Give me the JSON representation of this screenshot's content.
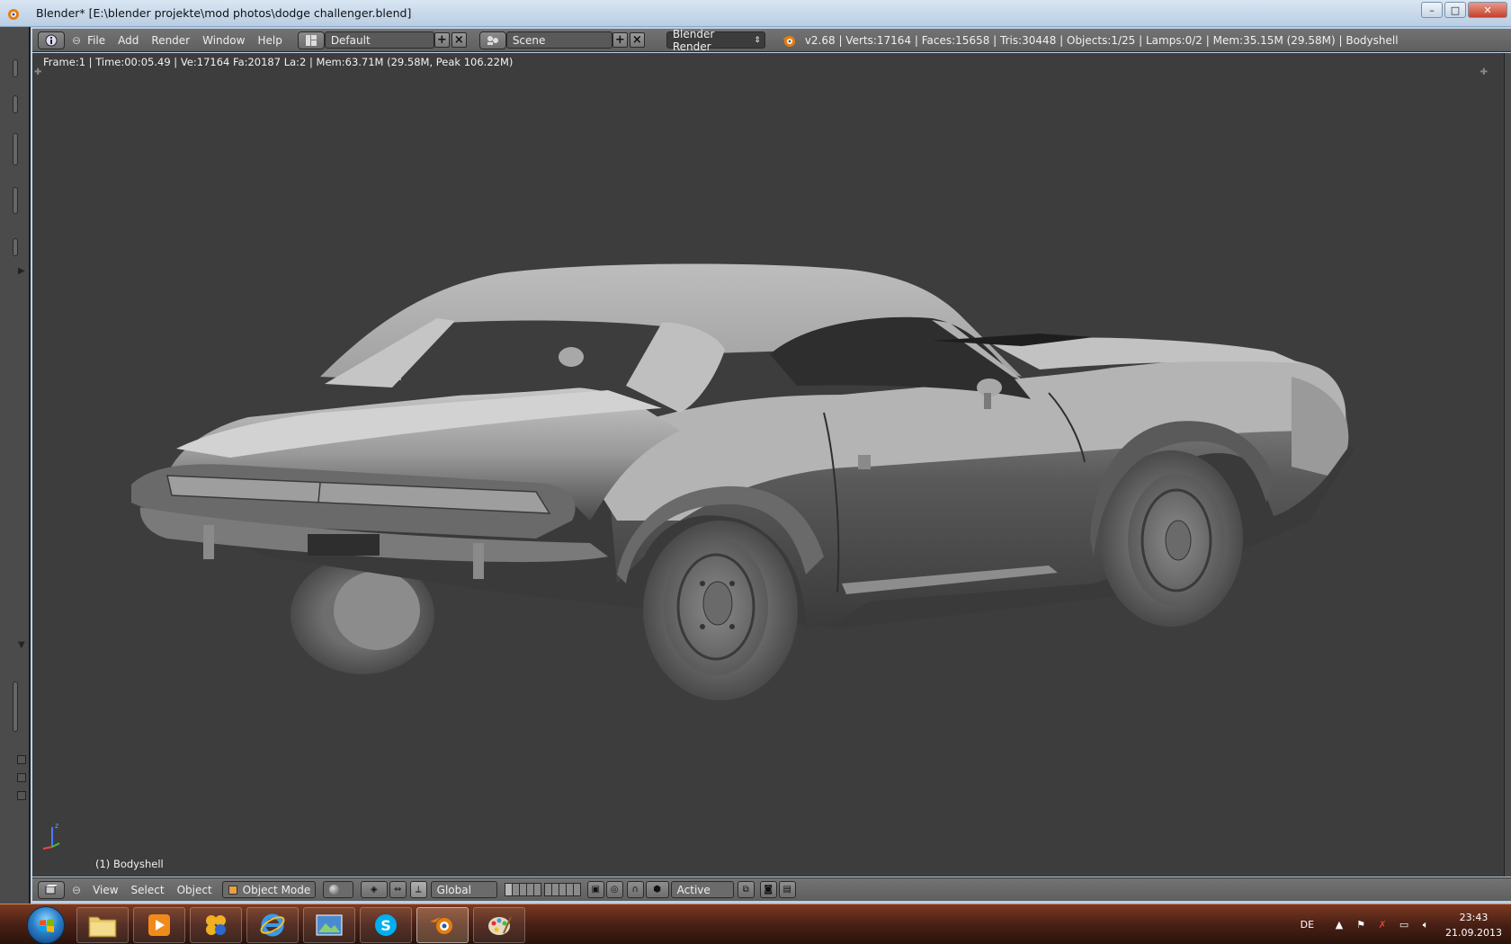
{
  "window": {
    "title": "Blender* [E:\\blender projekte\\mod photos\\dodge challenger.blend]",
    "controls": {
      "minimize": "–",
      "maximize": "□",
      "close": "✕"
    }
  },
  "info_header": {
    "menus": [
      "File",
      "Add",
      "Render",
      "Window",
      "Help"
    ],
    "layout": "Default",
    "scene": "Scene",
    "engine": "Blender Render",
    "stats": "v2.68 | Verts:17164 | Faces:15658 | Tris:30448 | Objects:1/25 | Lamps:0/2 | Mem:35.15M (29.58M) | Bodyshell"
  },
  "viewport": {
    "info": "Frame:1 | Time:00:05.49 | Ve:17164 Fa:20187 La:2 | Mem:63.71M (29.58M, Peak 106.22M)",
    "object_name": "(1) Bodyshell",
    "axis_labels": {
      "z": "z",
      "x": "x",
      "y": "y"
    }
  },
  "bottom_header": {
    "menus": [
      "View",
      "Select",
      "Object"
    ],
    "mode": "Object Mode",
    "orientation": "Global",
    "pivot": "Active"
  },
  "taskbar": {
    "apps": [
      "windows-explorer",
      "media-player",
      "game-app",
      "internet-explorer",
      "image-viewer",
      "skype",
      "blender",
      "paint"
    ],
    "active_app": "blender",
    "language": "DE",
    "time": "23:43",
    "date": "21.09.2013"
  },
  "colors": {
    "viewport_bg": "#3d3d3d",
    "header_bg": "#686868",
    "blender_orange": "#e87d0d",
    "taskbar": "#4a2015"
  }
}
